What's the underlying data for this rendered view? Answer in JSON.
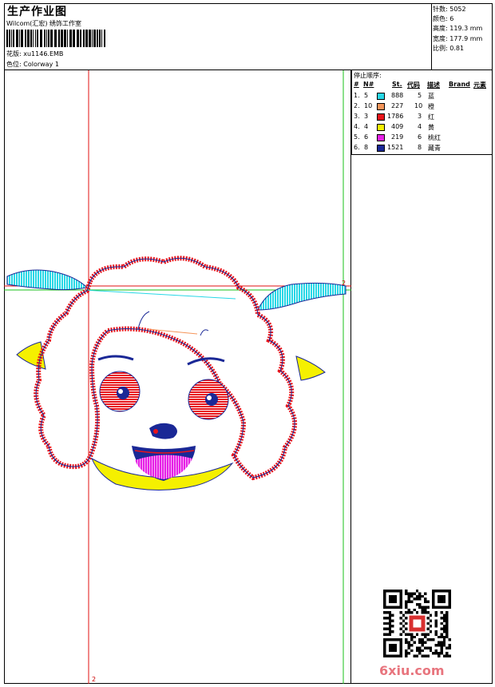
{
  "header": {
    "title": "生产作业图",
    "company": "Wilcom(汇宏) 绣饰工作室",
    "design_label": "花版:",
    "design_value": "xu1146.EMB",
    "colorway_label": "色位:",
    "colorway_value": "Colorway 1"
  },
  "specs": [
    {
      "label": "针数:",
      "value": "5052"
    },
    {
      "label": "颜色:",
      "value": "6"
    },
    {
      "label": "高度:",
      "value": "119.3 mm"
    },
    {
      "label": "宽度:",
      "value": "177.9 mm"
    },
    {
      "label": "比例:",
      "value": "0.81"
    }
  ],
  "stop_sequence": {
    "title": "停止顺序:",
    "columns": [
      "#",
      "N#",
      "St.",
      "代码",
      "描述",
      "Brand",
      "元素"
    ],
    "rows": [
      {
        "idx": "1.",
        "n": "5",
        "color": "#27d7e6",
        "st": "888",
        "code": "5",
        "desc": "蓝"
      },
      {
        "idx": "2.",
        "n": "10",
        "color": "#f5955a",
        "st": "227",
        "code": "10",
        "desc": "橙"
      },
      {
        "idx": "3.",
        "n": "3",
        "color": "#e8141b",
        "st": "1786",
        "code": "3",
        "desc": "红"
      },
      {
        "idx": "4.",
        "n": "4",
        "color": "#f5f000",
        "st": "409",
        "code": "4",
        "desc": "黄"
      },
      {
        "idx": "5.",
        "n": "6",
        "color": "#e620e6",
        "st": "219",
        "code": "6",
        "desc": "桃红"
      },
      {
        "idx": "6.",
        "n": "8",
        "color": "#1a2896",
        "st": "1521",
        "code": "8",
        "desc": "藏青"
      }
    ]
  },
  "markers": {
    "top_right": "2",
    "bottom": "2"
  },
  "watermark": "6xiu.com",
  "colors": {
    "red_guide": "#e01010",
    "green_guide": "#19c019",
    "accent": "#e8757e"
  }
}
